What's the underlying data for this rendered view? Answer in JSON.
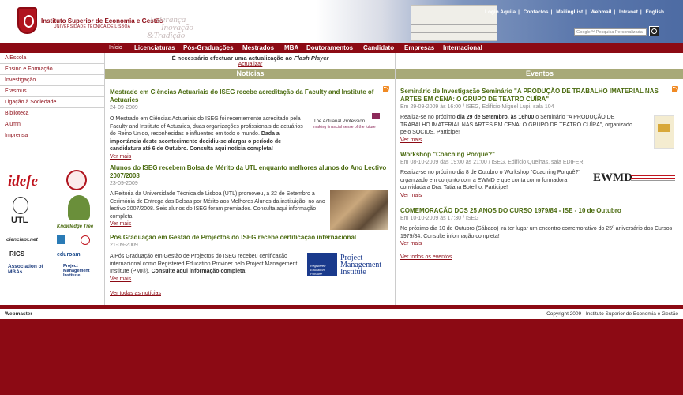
{
  "header": {
    "institution_name": "Instituto Superior de Economia e Gestão",
    "institution_sub": "UNIVERSIDADE TÉCNICA DE LISBOA",
    "slogan": [
      "Liderança",
      "Inovação",
      "&Tradição"
    ],
    "top_links": [
      "Login Aquila",
      "Contactos",
      "MailingList",
      "Webmail",
      "Intranet",
      "English"
    ],
    "search_placeholder": "Google™ Pesquisa Personalizada",
    "search_icon": "magnifier-icon"
  },
  "main_nav": [
    "Início",
    "Licenciaturas",
    "Pós-Graduações",
    "Mestrados",
    "MBA",
    "Doutoramentos",
    "Candidato",
    "Empresas",
    "Internacional"
  ],
  "left_menu": [
    "A Escola",
    "Ensino e Formação",
    "Investigação",
    "Erasmus",
    "Ligação à Sociedade",
    "Biblioteca",
    "Alumni",
    "Imprensa"
  ],
  "partners": [
    "idefe",
    "UTL",
    "Knowledge Tree",
    "cienciapt.net",
    "RICS",
    "eduroam",
    "Association of MBAs",
    "Project Management Institute"
  ],
  "notice": {
    "text_prefix": "É necessário efectuar uma actualização ao",
    "text_flash": "Flash Player",
    "link": "Actualizar"
  },
  "news": {
    "header": "Notícias",
    "items": [
      {
        "title": "Mestrado em Ciências Actuariais do ISEG recebe acreditação da  Faculty and Institute of Actuaries",
        "date": "24-09-2009",
        "body": "O Mestrado em Ciências Actuariais do ISEG foi recentemente acreditado pela Faculty and Institute of Actuaries, duas organizações profissionais de actuários do Reino Unido, reconhecidas e influentes em todo o mundo.",
        "body_bold": "Dada a importância deste acontecimento decidiu-se alargar o período de candidatura até 6 de Outubro. Consulta aqui notícia completa!",
        "more": "Ver mais",
        "image_caption": "The Actuarial Profession",
        "image_sub": "making financial sense of the future"
      },
      {
        "title": "Alunos do ISEG recebem Bolsa de Mérito da UTL enquanto melhores alunos do Ano Lectivo 2007/2008",
        "date": "23-09-2009",
        "body": "A Reitoria da Universidade Técnica de Lisboa (UTL) promoveu, a 22 de Setembro a Cerimónia de Entrega das Bolsas por Mérito aos Melhores Alunos da instituição, no ano lectivo 2007/2008. Seis alunos do ISEG foram premiados. Consulta aqui informação completa!",
        "more": "Ver mais"
      },
      {
        "title": "Pós Graduação em Gestão de Projectos do ISEG recebe certificação internacional",
        "date": "21-09-2009",
        "body": "A Pós Graduação em Gestão de Projectos do ISEG recebeu certificação internacional como Registered Education Provider pelo Project Management Institute (PMI®).",
        "body_bold": "Consulte aqui informação completa!",
        "more": "Ver mais",
        "image_caption": "Project Management Institute",
        "image_sub": "Registered Education Provider"
      }
    ],
    "all_link": "Ver todas as notícias"
  },
  "events": {
    "header": "Eventos",
    "items": [
      {
        "title": "Seminário de Investigação Seminário \"A PRODUÇÃO DE TRABALHO IMATERIAL NAS ARTES EM CENA: O GRUPO DE TEATRO CUÍRA\"",
        "date": "Em 29-09-2009 às 16:00 / ISEG, Edifício Miguel Lupi, sala 104",
        "body_prefix": "Realiza-se no próximo",
        "body_bold": "dia 29 de Setembro, às 16h00",
        "body": "o Seminário \"A PRODUÇÃO DE TRABALHO IMATERIAL NAS ARTES EM CENA: O GRUPO DE TEATRO CUÍRA\", organizado pelo SOCIUS. Participe!",
        "more": "Ver mais"
      },
      {
        "title": "Workshop \"Coaching Porquê?\"",
        "date": "Em 08-10-2009 das 19:00 às 21:00 / ISEG, Edifício Quelhas, sala EDIFER",
        "body": "Realiza-se no próximo dia 8 de Outubro o Workshop \"Coaching Porquê?\" organizado em conjunto com a EWMD e que conta como formadora convidada a Dra. Tatiana Botelho. Participe!",
        "more": "Ver mais",
        "image_caption": "EWMD"
      },
      {
        "title": "COMEMORAÇÃO DOS 25 ANOS DO CURSO 1979/84 - ISE - 10 de Outubro",
        "date": "Em 10-10-2009 às 17:30 / ISEG",
        "body": "No próximo dia 10 de Outubro (Sábado) irá ter lugar um encontro comemorativo do 25º aniversário dos Cursos 1979/84. Consulte informação completa!",
        "more": "Ver mais"
      }
    ],
    "all_link": "Ver todos os eventos"
  },
  "footer": {
    "webmaster": "Webmaster",
    "copyright": "Copyright 2009 - Instituto Superior de Economia e Gestão"
  },
  "colors": {
    "brand": "#8c0a14",
    "section_header": "#a8a978",
    "news_title": "#4b6b10"
  }
}
